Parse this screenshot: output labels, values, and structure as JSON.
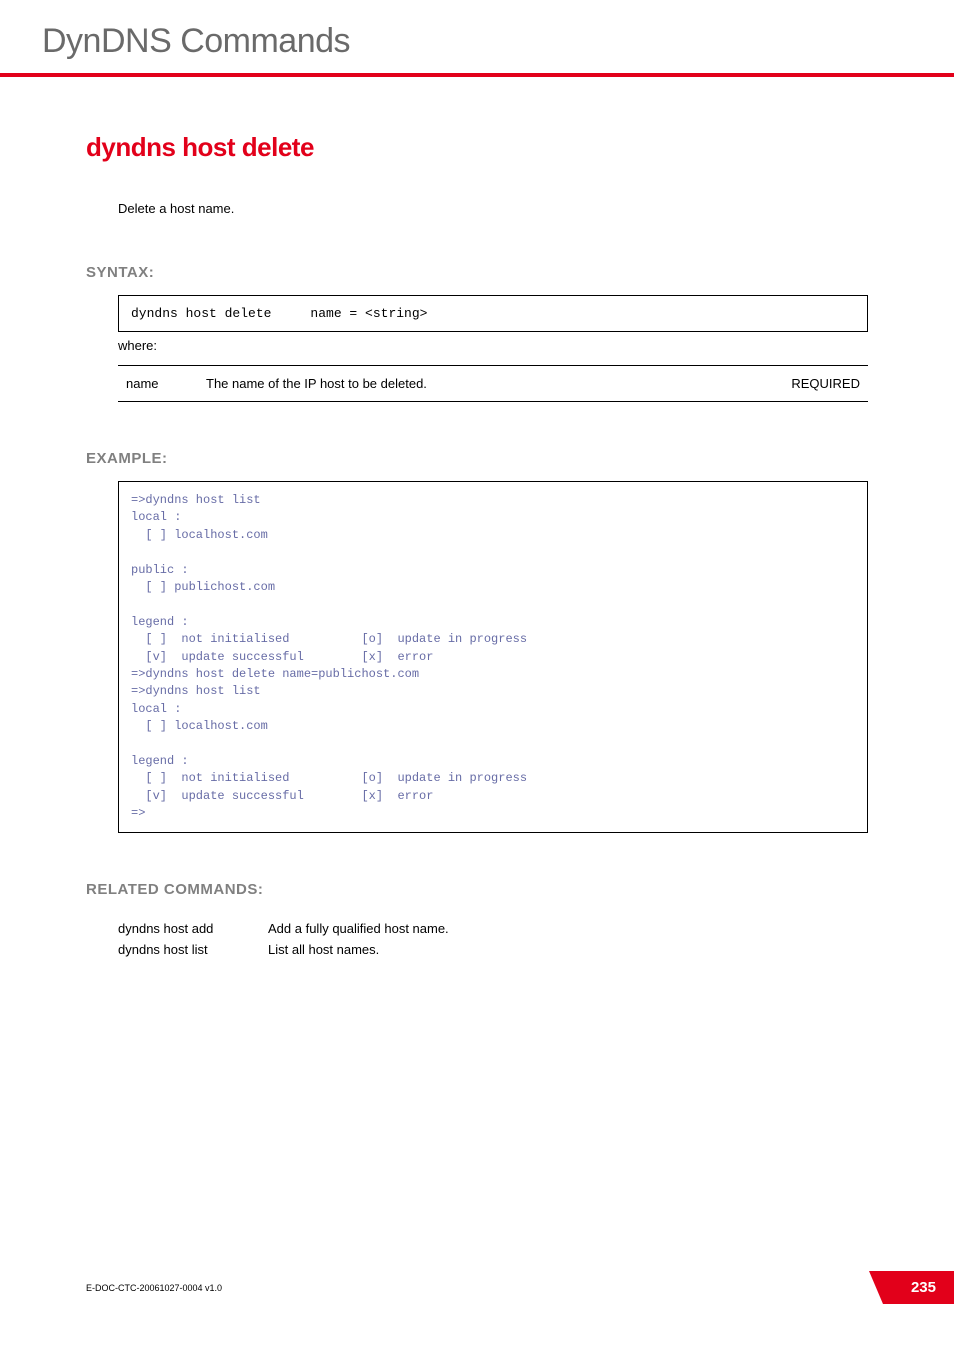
{
  "header": {
    "title": "DynDNS Commands"
  },
  "command": {
    "title": "dyndns host delete",
    "description": "Delete a host name."
  },
  "syntax": {
    "label": "SYNTAX:",
    "code": "dyndns host delete     name = <string>",
    "where": "where:",
    "params": [
      {
        "name": "name",
        "description": "The name of the IP host to be deleted.",
        "required": "REQUIRED"
      }
    ]
  },
  "example": {
    "label": "EXAMPLE:",
    "text": "=>dyndns host list\nlocal :\n  [ ] localhost.com\n\npublic :\n  [ ] publichost.com\n\nlegend :\n  [ ]  not initialised          [o]  update in progress\n  [v]  update successful        [x]  error\n=>dyndns host delete name=publichost.com\n=>dyndns host list\nlocal :\n  [ ] localhost.com\n\nlegend :\n  [ ]  not initialised          [o]  update in progress\n  [v]  update successful        [x]  error\n=>"
  },
  "related": {
    "label": "RELATED COMMANDS:",
    "items": [
      {
        "cmd": "dyndns host add",
        "desc": "Add a fully qualified host name."
      },
      {
        "cmd": "dyndns host list",
        "desc": "List all host names."
      }
    ]
  },
  "footer": {
    "docid": "E-DOC-CTC-20061027-0004 v1.0",
    "page": "235"
  }
}
